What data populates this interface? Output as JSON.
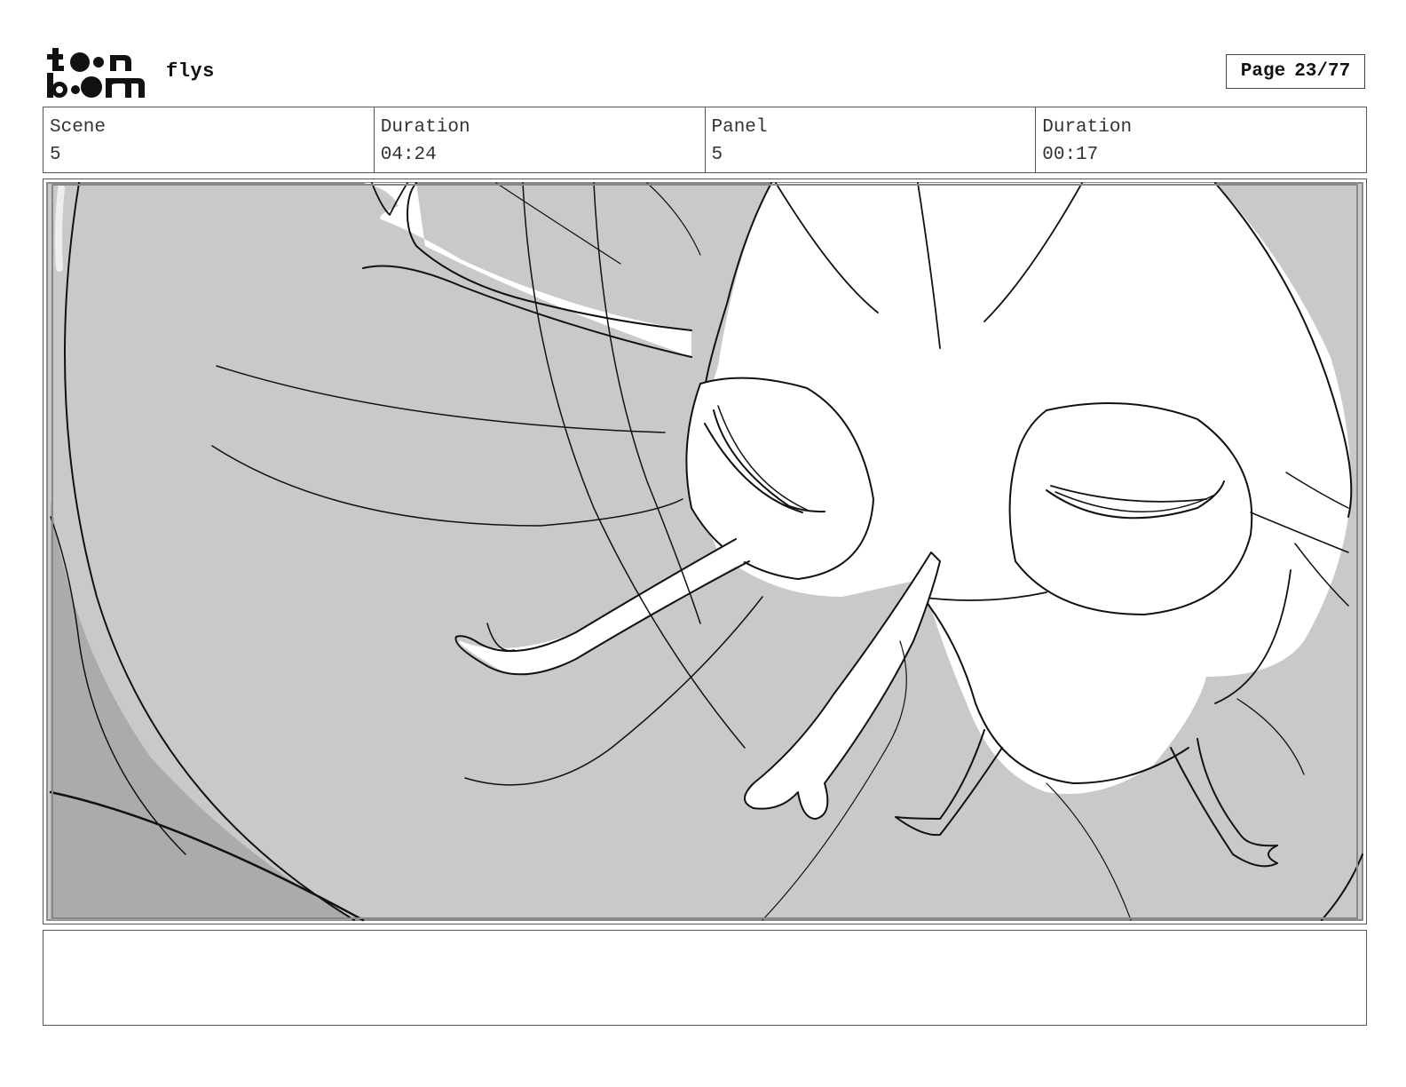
{
  "header": {
    "project_title": "flys",
    "page_label": "Page",
    "page_number": "23/77"
  },
  "info": {
    "scene_label": "Scene",
    "scene_value": "5",
    "scene_duration_label": "Duration",
    "scene_duration_value": "04:24",
    "panel_label": "Panel",
    "panel_value": "5",
    "panel_duration_label": "Duration",
    "panel_duration_value": "00:17"
  },
  "panel": {
    "image": "storyboard-sketch",
    "colors": {
      "background": "#c9c9c9",
      "shadow": "#a9a9a9",
      "line": "#111111",
      "fill": "#ffffff"
    }
  },
  "notes": {
    "text": ""
  }
}
